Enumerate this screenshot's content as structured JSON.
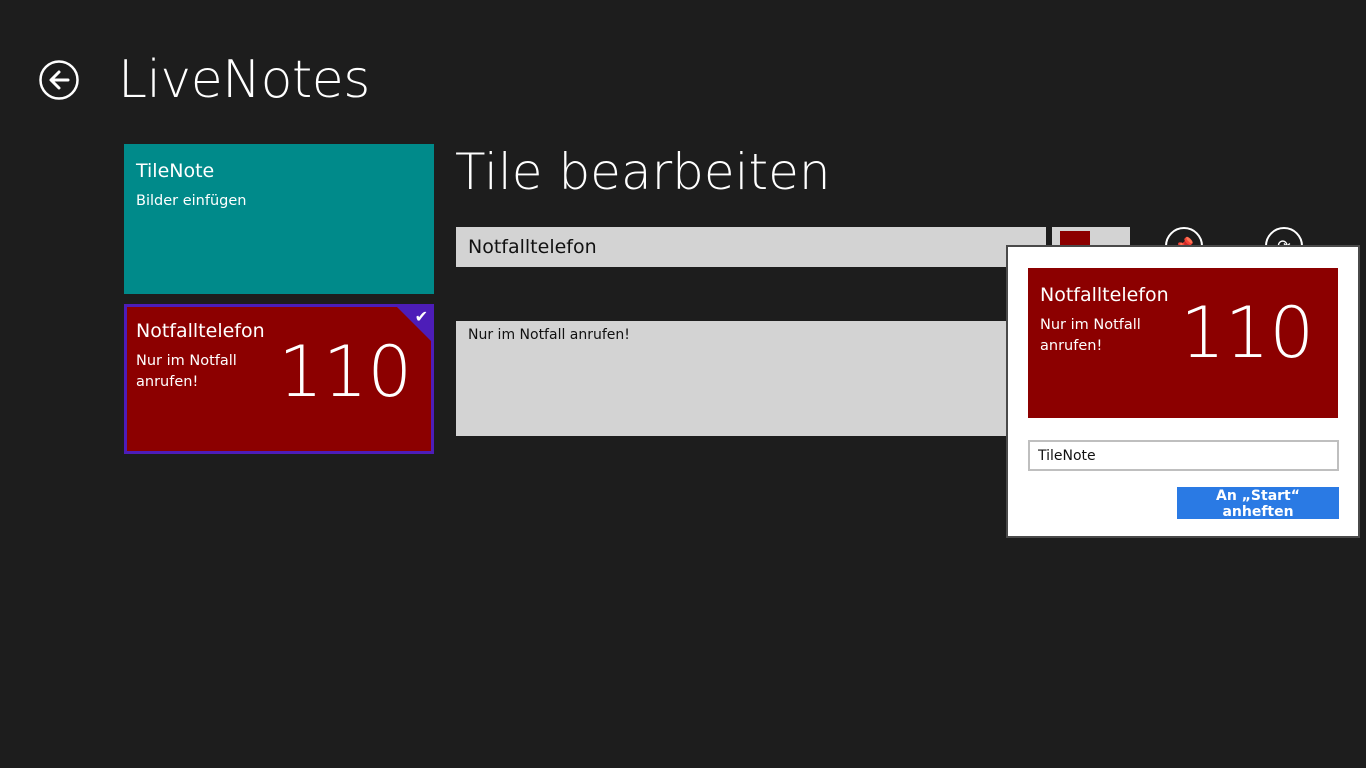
{
  "header": {
    "app_title": "LiveNotes"
  },
  "tiles": [
    {
      "title": "TileNote",
      "subtitle": "Bilder einfügen",
      "color": "#008a8a"
    },
    {
      "title": "Notfalltelefon",
      "subtitle": "Nur im Notfall anrufen!",
      "number": "110",
      "color": "#8c0000",
      "selected": true,
      "selection_color": "#4d1db8"
    }
  ],
  "editor": {
    "heading": "Tile bearbeiten",
    "title_value": "Notfalltelefon",
    "body_value": "Nur im Notfall anrufen!",
    "selected_color": "#8c0000"
  },
  "flyout": {
    "preview": {
      "title": "Notfalltelefon",
      "subtitle": "Nur im Notfall anrufen!",
      "number": "110"
    },
    "name_value": "TileNote",
    "pin_button_label": "An „Start“ anheften",
    "button_color": "#2a7ae4"
  },
  "icons": {
    "back": "back-arrow-icon",
    "pin": "pin-icon",
    "refresh": "refresh-icon",
    "check": "checkmark-icon"
  }
}
